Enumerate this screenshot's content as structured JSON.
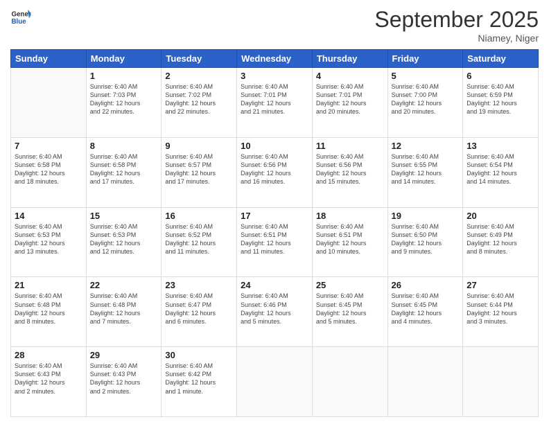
{
  "header": {
    "logo_line1": "General",
    "logo_line2": "Blue",
    "title": "September 2025",
    "location": "Niamey, Niger"
  },
  "weekdays": [
    "Sunday",
    "Monday",
    "Tuesday",
    "Wednesday",
    "Thursday",
    "Friday",
    "Saturday"
  ],
  "weeks": [
    [
      {
        "day": "",
        "info": ""
      },
      {
        "day": "1",
        "info": "Sunrise: 6:40 AM\nSunset: 7:03 PM\nDaylight: 12 hours\nand 22 minutes."
      },
      {
        "day": "2",
        "info": "Sunrise: 6:40 AM\nSunset: 7:02 PM\nDaylight: 12 hours\nand 22 minutes."
      },
      {
        "day": "3",
        "info": "Sunrise: 6:40 AM\nSunset: 7:01 PM\nDaylight: 12 hours\nand 21 minutes."
      },
      {
        "day": "4",
        "info": "Sunrise: 6:40 AM\nSunset: 7:01 PM\nDaylight: 12 hours\nand 20 minutes."
      },
      {
        "day": "5",
        "info": "Sunrise: 6:40 AM\nSunset: 7:00 PM\nDaylight: 12 hours\nand 20 minutes."
      },
      {
        "day": "6",
        "info": "Sunrise: 6:40 AM\nSunset: 6:59 PM\nDaylight: 12 hours\nand 19 minutes."
      }
    ],
    [
      {
        "day": "7",
        "info": "Sunrise: 6:40 AM\nSunset: 6:58 PM\nDaylight: 12 hours\nand 18 minutes."
      },
      {
        "day": "8",
        "info": "Sunrise: 6:40 AM\nSunset: 6:58 PM\nDaylight: 12 hours\nand 17 minutes."
      },
      {
        "day": "9",
        "info": "Sunrise: 6:40 AM\nSunset: 6:57 PM\nDaylight: 12 hours\nand 17 minutes."
      },
      {
        "day": "10",
        "info": "Sunrise: 6:40 AM\nSunset: 6:56 PM\nDaylight: 12 hours\nand 16 minutes."
      },
      {
        "day": "11",
        "info": "Sunrise: 6:40 AM\nSunset: 6:56 PM\nDaylight: 12 hours\nand 15 minutes."
      },
      {
        "day": "12",
        "info": "Sunrise: 6:40 AM\nSunset: 6:55 PM\nDaylight: 12 hours\nand 14 minutes."
      },
      {
        "day": "13",
        "info": "Sunrise: 6:40 AM\nSunset: 6:54 PM\nDaylight: 12 hours\nand 14 minutes."
      }
    ],
    [
      {
        "day": "14",
        "info": "Sunrise: 6:40 AM\nSunset: 6:53 PM\nDaylight: 12 hours\nand 13 minutes."
      },
      {
        "day": "15",
        "info": "Sunrise: 6:40 AM\nSunset: 6:53 PM\nDaylight: 12 hours\nand 12 minutes."
      },
      {
        "day": "16",
        "info": "Sunrise: 6:40 AM\nSunset: 6:52 PM\nDaylight: 12 hours\nand 11 minutes."
      },
      {
        "day": "17",
        "info": "Sunrise: 6:40 AM\nSunset: 6:51 PM\nDaylight: 12 hours\nand 11 minutes."
      },
      {
        "day": "18",
        "info": "Sunrise: 6:40 AM\nSunset: 6:51 PM\nDaylight: 12 hours\nand 10 minutes."
      },
      {
        "day": "19",
        "info": "Sunrise: 6:40 AM\nSunset: 6:50 PM\nDaylight: 12 hours\nand 9 minutes."
      },
      {
        "day": "20",
        "info": "Sunrise: 6:40 AM\nSunset: 6:49 PM\nDaylight: 12 hours\nand 8 minutes."
      }
    ],
    [
      {
        "day": "21",
        "info": "Sunrise: 6:40 AM\nSunset: 6:48 PM\nDaylight: 12 hours\nand 8 minutes."
      },
      {
        "day": "22",
        "info": "Sunrise: 6:40 AM\nSunset: 6:48 PM\nDaylight: 12 hours\nand 7 minutes."
      },
      {
        "day": "23",
        "info": "Sunrise: 6:40 AM\nSunset: 6:47 PM\nDaylight: 12 hours\nand 6 minutes."
      },
      {
        "day": "24",
        "info": "Sunrise: 6:40 AM\nSunset: 6:46 PM\nDaylight: 12 hours\nand 5 minutes."
      },
      {
        "day": "25",
        "info": "Sunrise: 6:40 AM\nSunset: 6:45 PM\nDaylight: 12 hours\nand 5 minutes."
      },
      {
        "day": "26",
        "info": "Sunrise: 6:40 AM\nSunset: 6:45 PM\nDaylight: 12 hours\nand 4 minutes."
      },
      {
        "day": "27",
        "info": "Sunrise: 6:40 AM\nSunset: 6:44 PM\nDaylight: 12 hours\nand 3 minutes."
      }
    ],
    [
      {
        "day": "28",
        "info": "Sunrise: 6:40 AM\nSunset: 6:43 PM\nDaylight: 12 hours\nand 2 minutes."
      },
      {
        "day": "29",
        "info": "Sunrise: 6:40 AM\nSunset: 6:43 PM\nDaylight: 12 hours\nand 2 minutes."
      },
      {
        "day": "30",
        "info": "Sunrise: 6:40 AM\nSunset: 6:42 PM\nDaylight: 12 hours\nand 1 minute."
      },
      {
        "day": "",
        "info": ""
      },
      {
        "day": "",
        "info": ""
      },
      {
        "day": "",
        "info": ""
      },
      {
        "day": "",
        "info": ""
      }
    ]
  ]
}
